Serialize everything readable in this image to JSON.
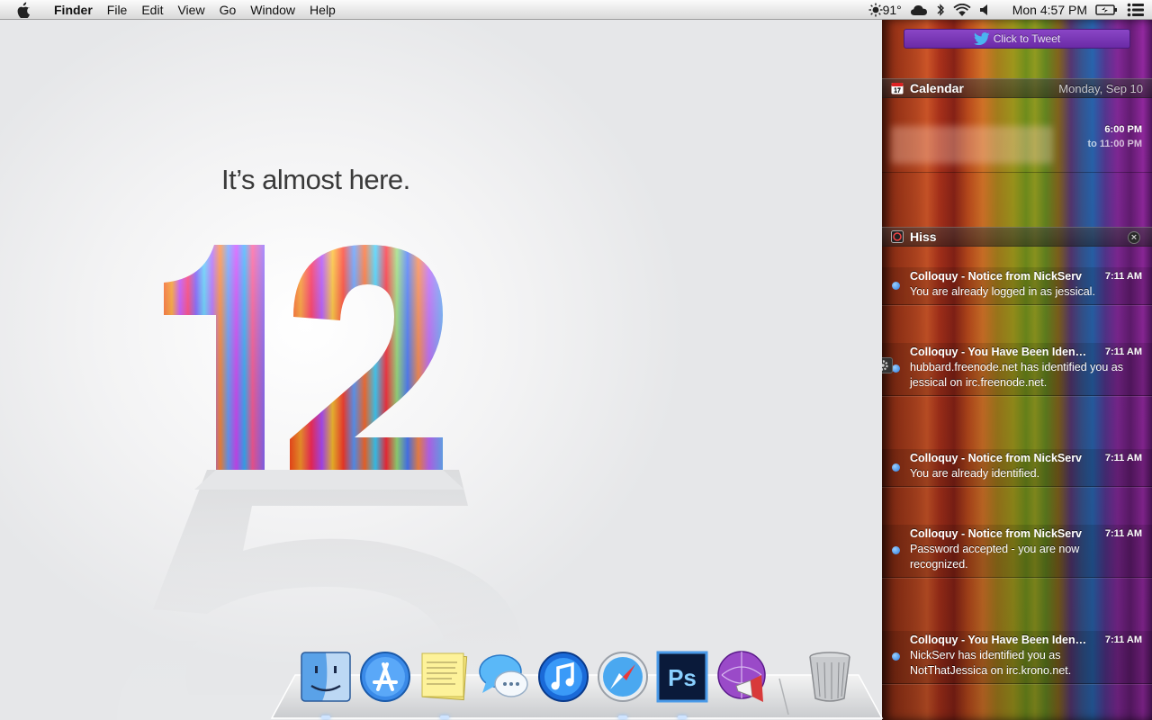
{
  "menubar": {
    "app_name": "Finder",
    "items": [
      "File",
      "Edit",
      "View",
      "Go",
      "Window",
      "Help"
    ],
    "status": {
      "weather_temp": "91°",
      "clock": "Mon 4:57 PM"
    }
  },
  "desktop": {
    "headline": "It’s almost here.",
    "big_number": "12",
    "ghost_number": "5"
  },
  "notification_center": {
    "tweet_button_label": "Click to Tweet",
    "calendar": {
      "label": "Calendar",
      "date": "Monday, Sep 10",
      "event_time": "6:00 PM",
      "event_end": "to 11:00 PM"
    },
    "hiss": {
      "label": "Hiss",
      "notifications": [
        {
          "title": "Colloquy - Notice from NickServ",
          "time": "7:11 AM",
          "body": "You are already logged in as jessical."
        },
        {
          "title": "Colloquy - You Have Been Iden…",
          "time": "7:11 AM",
          "body": "hubbard.freenode.net has identified you as jessical on irc.freenode.net."
        },
        {
          "title": "Colloquy - Notice from NickServ",
          "time": "7:11 AM",
          "body": "You are already identified."
        },
        {
          "title": "Colloquy - Notice from NickServ",
          "time": "7:11 AM",
          "body": "Password accepted - you are now recognized."
        },
        {
          "title": "Colloquy - You Have Been Iden…",
          "time": "7:11 AM",
          "body": "NickServ has identified you as NotThatJessica on irc.krono.net."
        }
      ]
    }
  },
  "dock": {
    "items": [
      "finder-icon",
      "app-store-icon",
      "stickies-icon",
      "messages-icon",
      "itunes-icon",
      "safari-icon",
      "photoshop-icon",
      "growl-icon",
      "trash-icon"
    ],
    "photoshop_label": "Ps"
  }
}
